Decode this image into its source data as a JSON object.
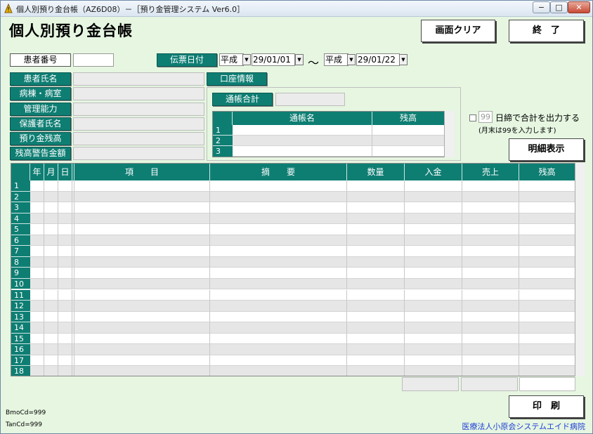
{
  "window": {
    "title": "個人別預り金台帳（AZ6D08）－［預り金管理システム Ver6.0］",
    "minimize_glyph": "−",
    "maximize_glyph": "□",
    "close_glyph": "✕"
  },
  "page": {
    "title": "個人別預り金台帳"
  },
  "buttons": {
    "clear": "画面クリア",
    "exit": "終　了",
    "detail": "明細表示",
    "print": "印　刷"
  },
  "patient": {
    "number_label": "患者番号",
    "number_value": "",
    "name_label": "患者氏名",
    "ward_label": "病棟・病室",
    "mgmt_label": "管理能力",
    "guardian_label": "保護者氏名",
    "balance_label": "預り金残高",
    "warn_label": "残高警告金額"
  },
  "date_filter": {
    "label": "伝票日付",
    "from_era": "平成",
    "from_date": "29/01/01",
    "separator": "～",
    "to_era": "平成",
    "to_date": "29/01/22"
  },
  "account": {
    "tab_label": "口座情報",
    "total_label": "通帳合計",
    "columns": [
      "通帳名",
      "残高"
    ],
    "rows": [
      "1",
      "2",
      "3"
    ]
  },
  "option": {
    "days_value": "99",
    "text": "日締で合計を出力する",
    "note": "(月末は99を入力します)"
  },
  "grid": {
    "columns": [
      "年",
      "月",
      "日",
      "項　　目",
      "摘　　要",
      "数量",
      "入金",
      "売上",
      "残高"
    ],
    "rows": [
      "1",
      "2",
      "3",
      "4",
      "5",
      "6",
      "7",
      "8",
      "9",
      "10",
      "11",
      "12",
      "13",
      "14",
      "15",
      "16",
      "17",
      "18"
    ]
  },
  "footer": {
    "bmo": "BmoCd=999",
    "tan": "TanCd=999",
    "org": "医療法人小原会システムエイド病院"
  },
  "colors": {
    "background": "#e6f6e1",
    "header_teal": "#0e7e73",
    "stripe": "#e6e6e6",
    "org_blue": "#1f3fd6"
  }
}
